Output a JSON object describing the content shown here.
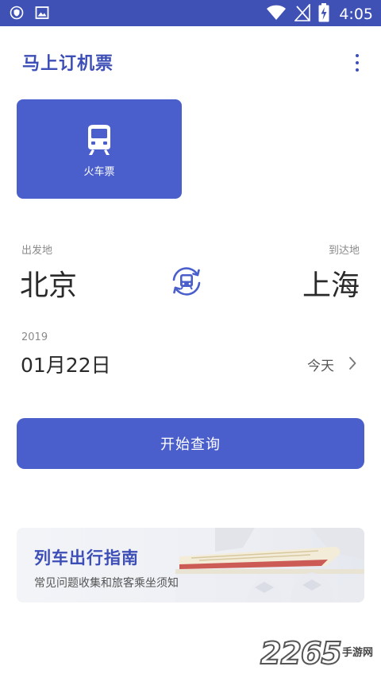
{
  "status_bar": {
    "time": "4:05",
    "icons": [
      "shield-icon",
      "image-icon",
      "wifi-icon",
      "no-signal-icon",
      "battery-charging-icon"
    ]
  },
  "app_bar": {
    "title": "马上订机票",
    "menu_icon": "more-vertical-icon"
  },
  "ticket_type": {
    "label": "火车票",
    "icon": "train-icon"
  },
  "stations": {
    "from_label": "出发地",
    "from": "北京",
    "to_label": "到达地",
    "to": "上海",
    "swap_icon": "swap-icon"
  },
  "date": {
    "year": "2019",
    "value": "01月22日",
    "relative": "今天",
    "chevron_icon": "chevron-right-icon"
  },
  "search_button": {
    "label": "开始查询"
  },
  "guide": {
    "title": "列车出行指南",
    "subtitle": "常见问题收集和旅客乘坐须知"
  },
  "watermark": {
    "number": "2265",
    "site": "手游网"
  },
  "colors": {
    "primary": "#4a5fcc",
    "status_bar": "#3f51b5",
    "title": "#3d4fb7"
  }
}
